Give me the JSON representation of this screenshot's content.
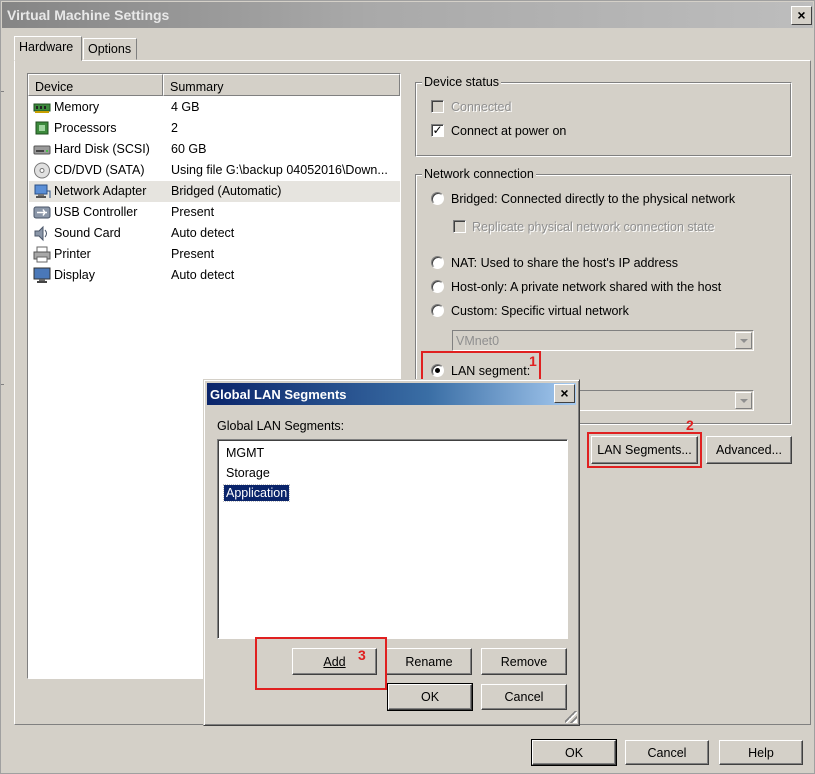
{
  "window": {
    "title": "Virtual Machine Settings",
    "close_glyph": "×",
    "tabs": [
      {
        "label": "Hardware"
      },
      {
        "label": "Options"
      }
    ]
  },
  "device_list": {
    "columns": [
      "Device",
      "Summary"
    ],
    "rows": [
      {
        "name": "Memory",
        "summary": "4 GB",
        "icon": "memory-icon"
      },
      {
        "name": "Processors",
        "summary": "2",
        "icon": "processor-icon"
      },
      {
        "name": "Hard Disk (SCSI)",
        "summary": "60 GB",
        "icon": "hard-disk-icon"
      },
      {
        "name": "CD/DVD (SATA)",
        "summary": "Using file G:\\backup 04052016\\Down...",
        "icon": "cd-dvd-icon"
      },
      {
        "name": "Network Adapter",
        "summary": "Bridged (Automatic)",
        "icon": "network-adapter-icon",
        "selected": true
      },
      {
        "name": "USB Controller",
        "summary": "Present",
        "icon": "usb-icon"
      },
      {
        "name": "Sound Card",
        "summary": "Auto detect",
        "icon": "sound-card-icon"
      },
      {
        "name": "Printer",
        "summary": "Present",
        "icon": "printer-icon"
      },
      {
        "name": "Display",
        "summary": "Auto detect",
        "icon": "display-icon"
      }
    ]
  },
  "device_status": {
    "title": "Device status",
    "connected": {
      "label": "Connected",
      "checked": false,
      "disabled": true
    },
    "connect_at_power_on": {
      "label": "Connect at power on",
      "checked": true
    }
  },
  "network_connection": {
    "title": "Network connection",
    "bridged": {
      "label": "Bridged: Connected directly to the physical network",
      "selected": false
    },
    "replicate": {
      "label": "Replicate physical network connection state",
      "checked": false,
      "disabled": true
    },
    "nat": {
      "label": "NAT: Used to share the host's IP address",
      "selected": false
    },
    "host_only": {
      "label": "Host-only: A private network shared with the host",
      "selected": false
    },
    "custom": {
      "label": "Custom: Specific virtual network",
      "selected": false
    },
    "custom_value": "VMnet0",
    "lan_segment": {
      "label": "LAN segment:",
      "selected": true
    },
    "lan_segment_value": ""
  },
  "buttons": {
    "lan_segments": "LAN Segments...",
    "advanced": "Advanced...",
    "ok": "OK",
    "cancel": "Cancel",
    "help": "Help"
  },
  "annotations": {
    "marker_1": "1",
    "marker_2": "2",
    "marker_3": "3",
    "color": "#e02020"
  },
  "dialog": {
    "title": "Global LAN Segments",
    "close_glyph": "×",
    "list_label": "Global LAN Segments:",
    "items": [
      {
        "label": "MGMT",
        "selected": false
      },
      {
        "label": "Storage",
        "selected": false
      },
      {
        "label": "Application",
        "selected": true
      }
    ],
    "add": "Add",
    "rename": "Rename",
    "remove": "Remove",
    "ok": "OK",
    "cancel": "Cancel"
  }
}
